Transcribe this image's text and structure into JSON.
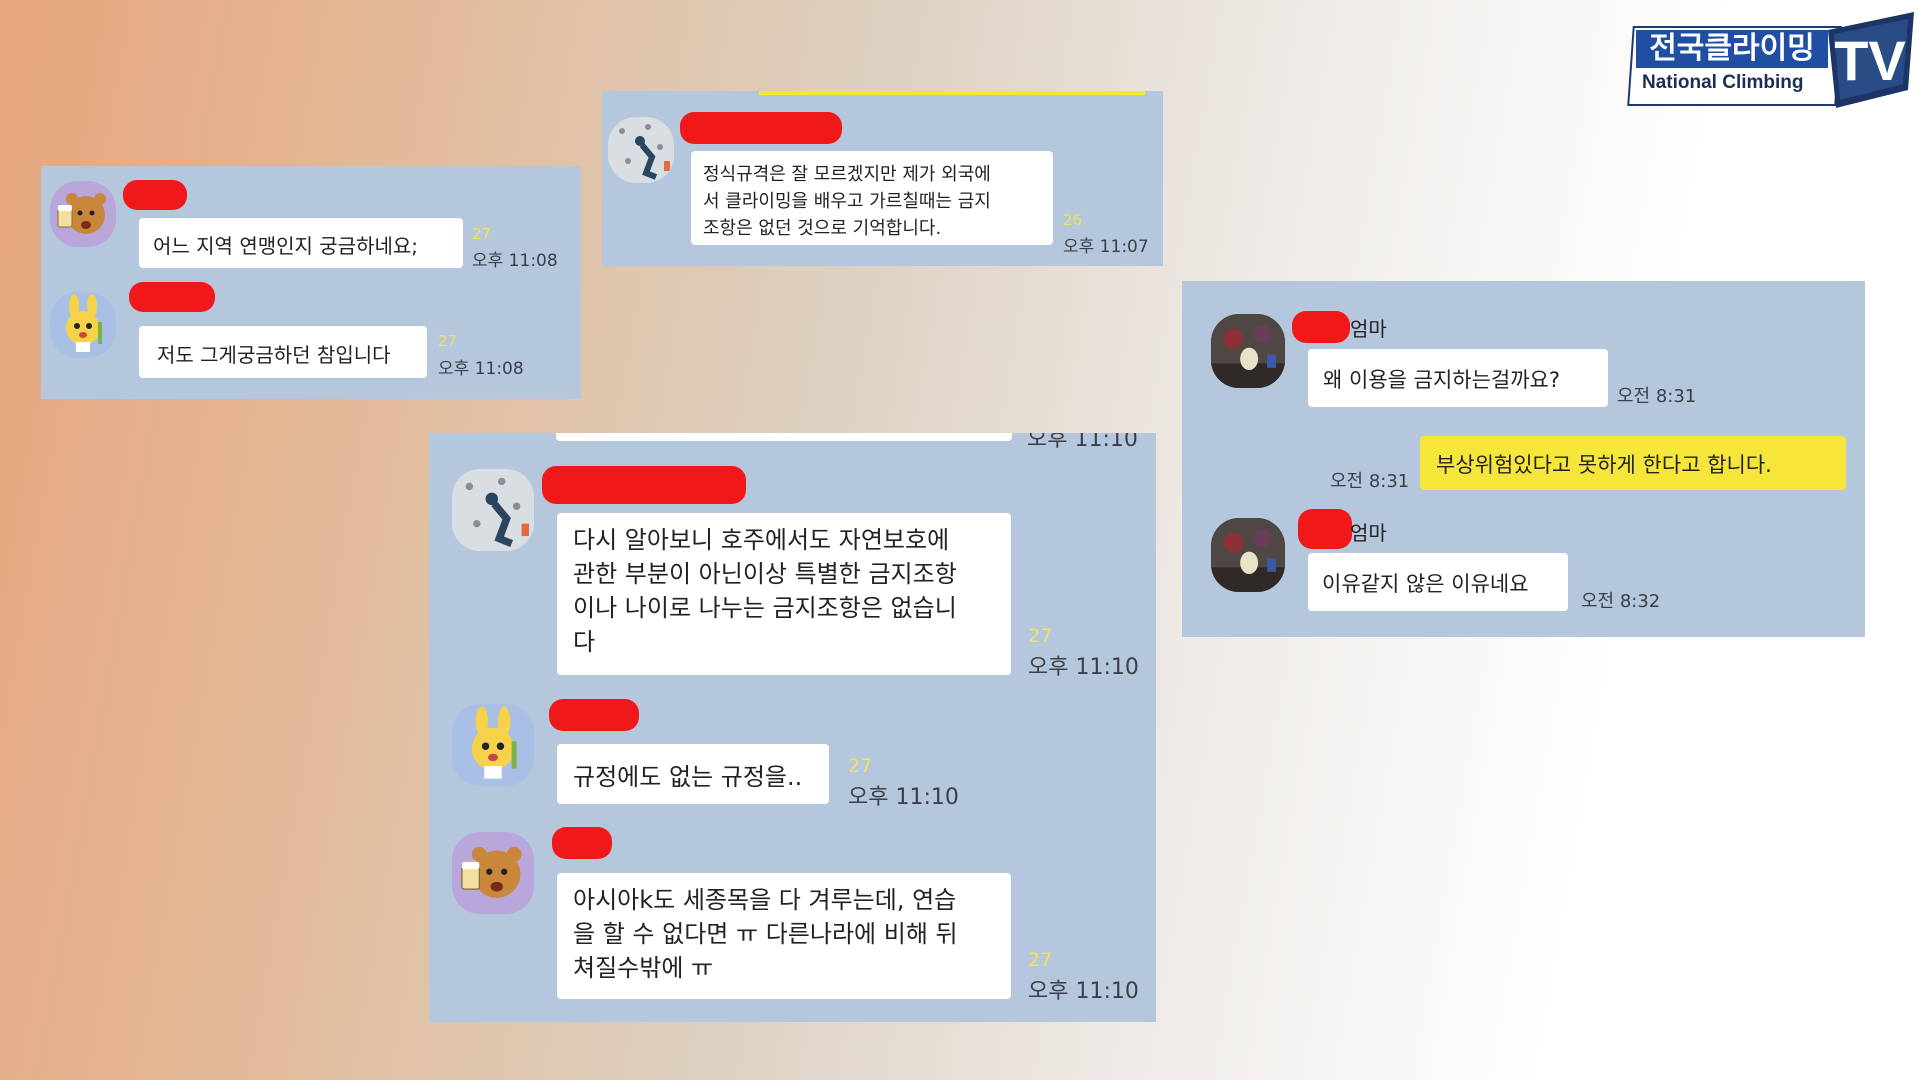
{
  "logo": {
    "korean": "전국클라이밍",
    "english": "National Climbing",
    "tv": "TV"
  },
  "panel_a": {
    "messages": [
      {
        "text": "어느 지역 연맹인지 궁금하네요;",
        "unread": "27",
        "time": "오후 11:08"
      },
      {
        "text": "저도 그게궁금하던 참입니다",
        "unread": "27",
        "time": "오후 11:08"
      }
    ]
  },
  "panel_b": {
    "messages": [
      {
        "text": "정식규격은 잘 모르겠지만 제가 외국에\n서 클라이밍을 배우고 가르칠때는 금지\n조항은 없던 것으로 기억합니다.",
        "unread": "26",
        "time": "오후 11:07"
      }
    ]
  },
  "panel_c": {
    "cut_time": "오후 11:10",
    "messages": [
      {
        "text": "다시 알아보니 호주에서도 자연보호에\n관한 부분이 아닌이상 특별한 금지조항\n이나 나이로 나누는 금지조항은 없습니\n다",
        "unread": "27",
        "time": "오후 11:10"
      },
      {
        "text": "규정에도 없는 규정을..",
        "unread": "27",
        "time": "오후 11:10"
      },
      {
        "text": "아시아k도 세종목을 다 겨루는데, 연습\n을 할 수 없다면 ㅠ 다른나라에 비해 뒤\n쳐질수밖에 ㅠ",
        "unread": "27",
        "time": "오후 11:10"
      }
    ]
  },
  "panel_d": {
    "name_suffix_1": "엄마",
    "msg1": {
      "text": "왜 이용을 금지하는걸까요?",
      "time": "오전 8:31"
    },
    "mine": {
      "text": "부상위험있다고 못하게 한다고 합니다.",
      "time": "오전 8:31"
    },
    "name_suffix_2": "엄마",
    "msg2": {
      "text": "이유같지 않은 이유네요",
      "time": "오전 8:32"
    }
  },
  "colors": {
    "panel_bg": "#b5c7dd",
    "redaction": "#f01818",
    "my_bubble": "#f7e63a",
    "unread": "#f3e35a"
  },
  "icons": [
    "ryan-beer-avatar",
    "rabbit-avatar",
    "climbing-photo-avatar",
    "figure-photo-avatar"
  ]
}
